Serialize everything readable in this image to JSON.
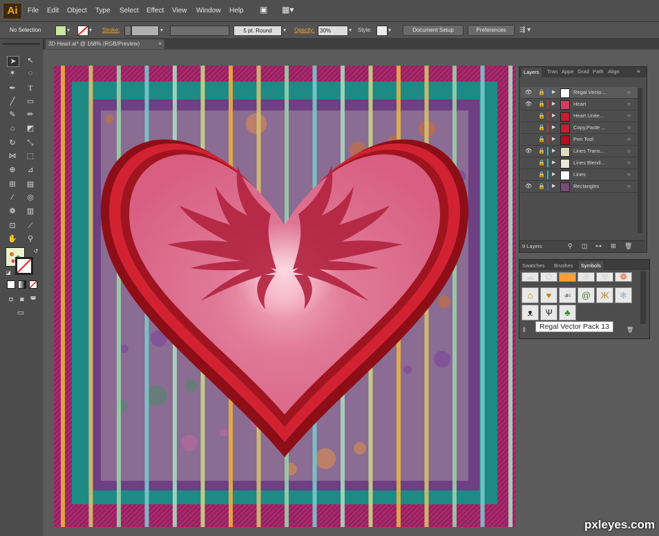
{
  "app": {
    "logo": "Ai"
  },
  "menu": [
    "File",
    "Edit",
    "Object",
    "Type",
    "Select",
    "Effect",
    "View",
    "Window",
    "Help"
  ],
  "control": {
    "selection": "No Selection",
    "stroke_label": "Stroke:",
    "brush": "5 pt. Round",
    "opacity_label": "Opacity:",
    "opacity_value": "30%",
    "style_label": "Style:",
    "document_setup": "Document Setup",
    "preferences": "Preferences"
  },
  "document": {
    "tab": "3D Heart.ai* @ 168% (RGB/Preview)"
  },
  "layers_panel": {
    "tabs": [
      "Layers",
      "Tran",
      "Appe",
      "Grad",
      "Path",
      "Align"
    ],
    "layers": [
      {
        "name": "Regal Vecto...",
        "color": "#3b5fd6",
        "thumb": "#ffffff",
        "visible": true,
        "selected": true
      },
      {
        "name": "Heart",
        "color": "#e02020",
        "thumb": "#d04060",
        "visible": true,
        "selected": false
      },
      {
        "name": "Heart Unite...",
        "color": "#e02020",
        "thumb": "#c02030",
        "visible": false,
        "selected": false
      },
      {
        "name": "Copy,Paste ...",
        "color": "#e02020",
        "thumb": "#c02030",
        "visible": false,
        "selected": false
      },
      {
        "name": "Pen Tool",
        "color": "#e02020",
        "thumb": "#b01020",
        "visible": false,
        "selected": false
      },
      {
        "name": "Lines Trans...",
        "color": "#20c0c0",
        "thumb": "#dcdcc0",
        "visible": true,
        "selected": false
      },
      {
        "name": "Lines Blend...",
        "color": "#20c0c0",
        "thumb": "#e8e8d8",
        "visible": false,
        "selected": false
      },
      {
        "name": "Lines",
        "color": "#20c0c0",
        "thumb": "#ffffff",
        "visible": false,
        "selected": false
      },
      {
        "name": "Rectangles",
        "color": "#3b5fd6",
        "thumb": "#7a4a7a",
        "visible": true,
        "selected": false
      }
    ],
    "count": "9 Layers"
  },
  "symbols_panel": {
    "tabs": [
      "Swatches",
      "Brushes",
      "Symbols"
    ],
    "tooltip": "Regal Vector Pack 13"
  },
  "colors": {
    "heart_outer": "#a3101c",
    "heart_mid": "#d42030",
    "heart_inner": "#e06a8a",
    "background_purple": "#7a4a7f",
    "teal": "#1d8a86",
    "magenta": "#a8286c"
  },
  "watermark": "pxleyes.com"
}
